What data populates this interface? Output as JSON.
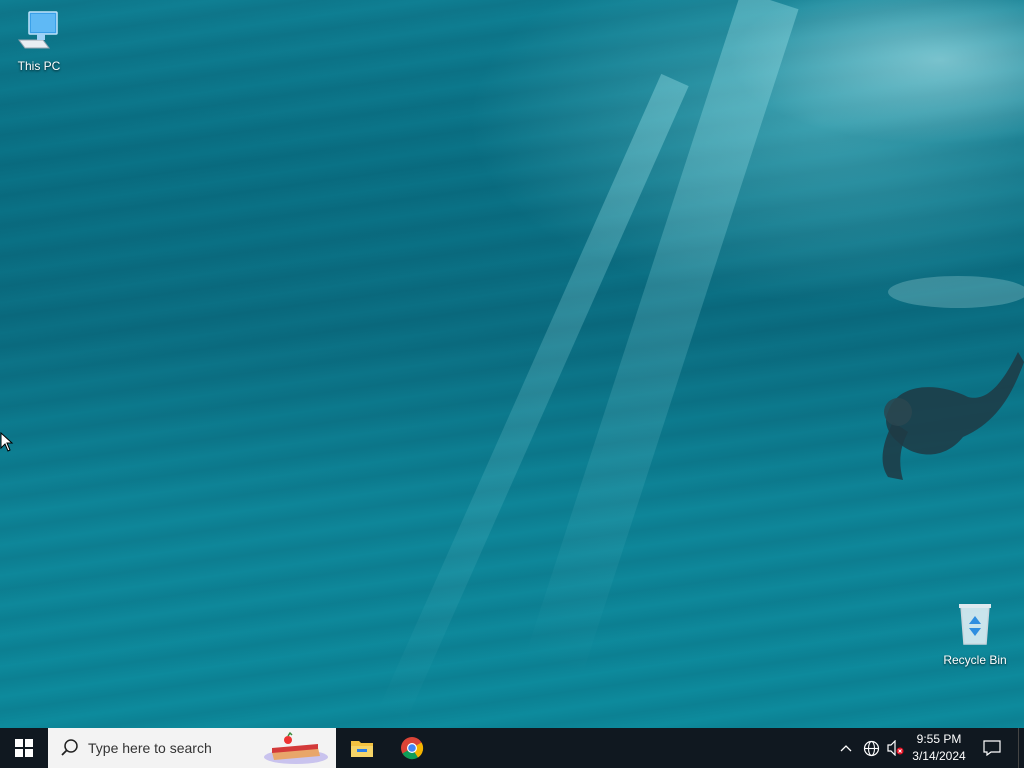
{
  "desktop": {
    "wallpaper": "underwater swimmer",
    "icons": [
      {
        "label": "This PC",
        "icon": "this-pc-icon"
      },
      {
        "label": "Recycle Bin",
        "icon": "recycle-bin-icon"
      }
    ]
  },
  "taskbar": {
    "start_icon": "windows-logo-icon",
    "search": {
      "placeholder": "Type here to search"
    },
    "pinned_apps": [
      {
        "name": "File Explorer",
        "icon": "file-explorer-icon"
      },
      {
        "name": "Google Chrome",
        "icon": "chrome-icon"
      }
    ],
    "tray": {
      "icons": [
        "chevron-up-icon",
        "network-icon",
        "volume-muted-icon"
      ],
      "time": "9:55 PM",
      "date": "3/14/2024",
      "notification_icon": "action-center-icon"
    }
  },
  "colors": {
    "taskbar_bg": "#101820",
    "search_bg": "#f3f3f3",
    "ocean": "#0b7286"
  }
}
